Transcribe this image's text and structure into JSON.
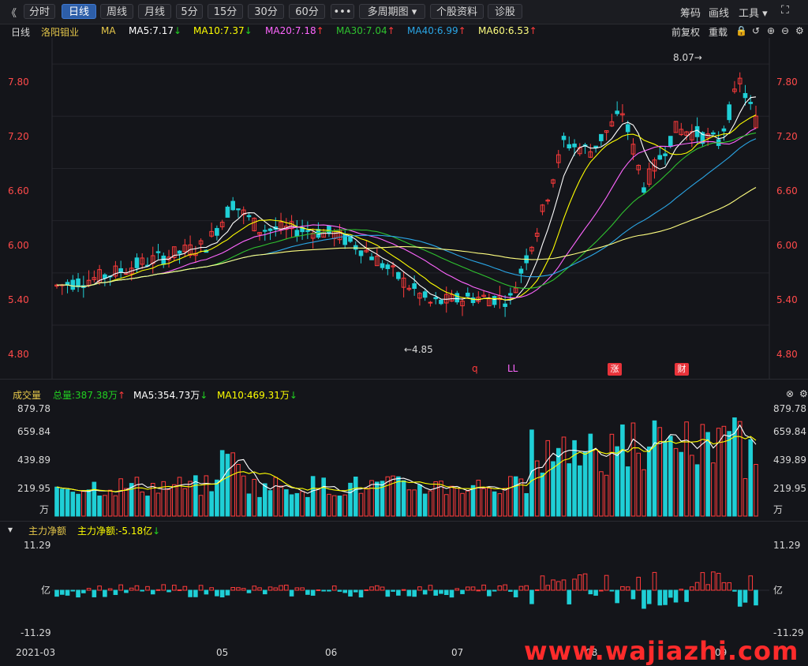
{
  "toolbar": {
    "back": "《",
    "tabs": [
      "分时",
      "日线",
      "周线",
      "月线",
      "5分",
      "15分",
      "30分",
      "60分"
    ],
    "more": "•••",
    "multi": "多周期图 ▾",
    "stock_info": "个股资料",
    "diagnose": "诊股",
    "right": [
      "筹码",
      "画线",
      "工具 ▾"
    ]
  },
  "ma_line": {
    "period": "日线",
    "name": "洛阳钼业",
    "ma": "MA",
    "ma5": "MA5:7.17",
    "ma10": "MA10:7.37",
    "ma20": "MA20:7.18",
    "ma30": "MA30:7.04",
    "ma40": "MA40:6.99",
    "ma60": "MA60:6.53",
    "fq": "前复权",
    "reweight": "重载",
    "colors": {
      "ma5": "#ffffff",
      "ma10": "#ffff00",
      "ma20": "#ff66ff",
      "ma30": "#2fc32f",
      "ma40": "#2aa6e6",
      "ma60": "#ffff80"
    }
  },
  "price_axis": [
    "7.80",
    "7.20",
    "6.60",
    "6.00",
    "5.40",
    "4.80"
  ],
  "annotations": {
    "high": "8.07→",
    "low": "←4.85",
    "q": "q",
    "ll": "LL",
    "zhang": "涨",
    "cai": "财"
  },
  "volume": {
    "title": "成交量",
    "total": "总量:387.38万",
    "ma5": "MA5:354.73万",
    "ma10": "MA10:469.31万",
    "axis": [
      "879.78",
      "659.84",
      "439.89",
      "219.95"
    ],
    "unit": "万",
    "close": "⊗"
  },
  "flow": {
    "title": "主力净额",
    "net": "主力净额:-5.18亿",
    "axis_top": "11.29",
    "axis_mid": "亿",
    "axis_bot": "-11.29"
  },
  "dates": [
    "2021-03",
    "05",
    "06",
    "07",
    "08",
    "09"
  ],
  "watermark": "www.wajiazhi.com",
  "chart_data": {
    "type": "candlestick",
    "title": "洛阳钼业 日线",
    "ylim": [
      4.8,
      8.1
    ],
    "high_label": 8.07,
    "low_label": 4.85
  }
}
